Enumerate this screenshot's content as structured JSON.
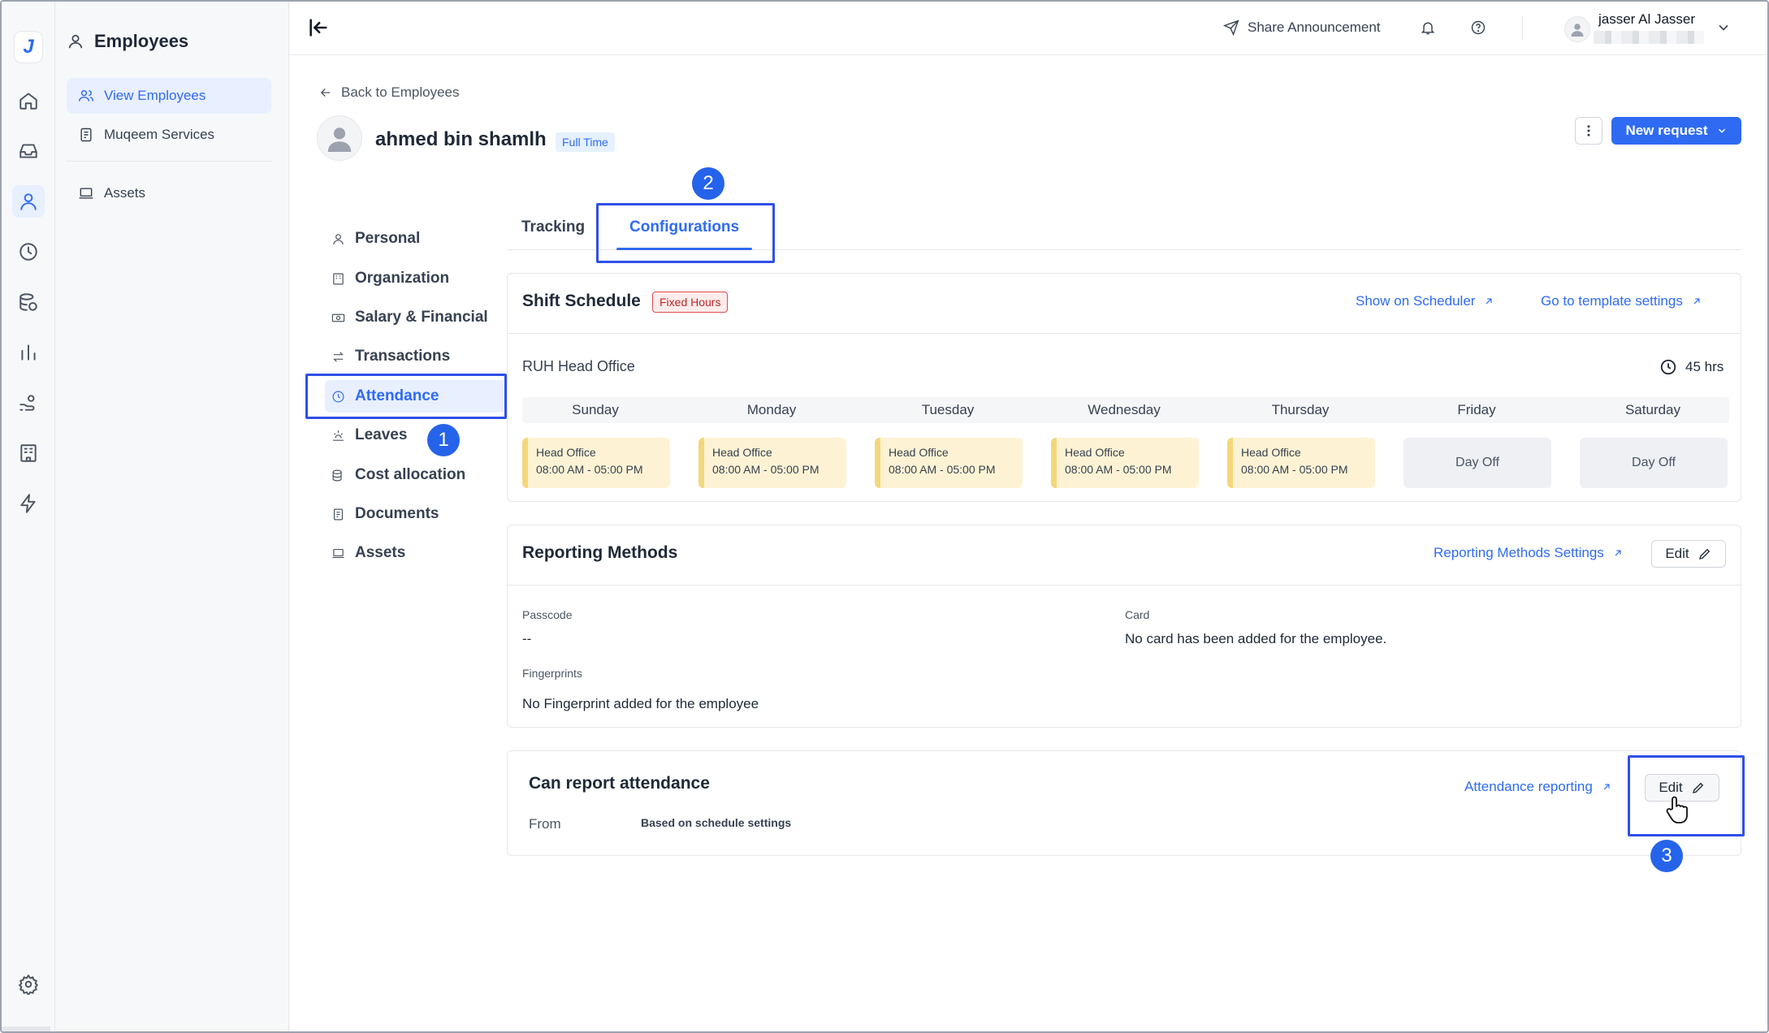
{
  "sidebar": {
    "title": "Employees",
    "items": [
      {
        "label": "View Employees",
        "icon": "users-icon",
        "active": true
      },
      {
        "label": "Muqeem Services",
        "icon": "document-icon"
      },
      {
        "label": "Assets",
        "icon": "laptop-icon"
      }
    ]
  },
  "rail": {
    "logo": "J",
    "icons": [
      "home-icon",
      "inbox-icon",
      "person-icon",
      "clock-icon",
      "database-icon",
      "bar-chart-icon",
      "hand-coins-icon",
      "building-icon",
      "bolt-icon",
      "settings-icon"
    ]
  },
  "topbar": {
    "share_label": "Share Announcement",
    "user_name": "jasser Al Jasser"
  },
  "page": {
    "back_label": "Back to Employees",
    "employee_name": "ahmed bin shamlh",
    "employment_badge": "Full Time",
    "new_request_label": "New request"
  },
  "section_nav": [
    {
      "label": "Personal",
      "icon": "person-icon"
    },
    {
      "label": "Organization",
      "icon": "building-icon"
    },
    {
      "label": "Salary & Financial",
      "icon": "money-icon"
    },
    {
      "label": "Transactions",
      "icon": "arrows-icon"
    },
    {
      "label": "Attendance",
      "icon": "clock-icon",
      "active": true
    },
    {
      "label": "Leaves",
      "icon": "sunset-icon"
    },
    {
      "label": "Cost allocation",
      "icon": "coins-icon"
    },
    {
      "label": "Documents",
      "icon": "document-icon"
    },
    {
      "label": "Assets",
      "icon": "laptop-icon"
    }
  ],
  "tabs": [
    {
      "label": "Tracking"
    },
    {
      "label": "Configurations",
      "active": true
    }
  ],
  "shift_schedule": {
    "title": "Shift Schedule",
    "badge": "Fixed Hours",
    "show_on_scheduler": "Show on Scheduler",
    "template_settings": "Go to template settings",
    "location": "RUH Head Office",
    "total_hours": "45 hrs",
    "days": [
      {
        "day": "Sunday",
        "location": "Head Office",
        "time": "08:00 AM - 05:00 PM"
      },
      {
        "day": "Monday",
        "location": "Head Office",
        "time": "08:00 AM - 05:00 PM"
      },
      {
        "day": "Tuesday",
        "location": "Head Office",
        "time": "08:00 AM - 05:00 PM"
      },
      {
        "day": "Wednesday",
        "location": "Head Office",
        "time": "08:00 AM - 05:00 PM"
      },
      {
        "day": "Thursday",
        "location": "Head Office",
        "time": "08:00 AM - 05:00 PM"
      },
      {
        "day": "Friday",
        "off": "Day Off"
      },
      {
        "day": "Saturday",
        "off": "Day Off"
      }
    ]
  },
  "reporting_methods": {
    "title": "Reporting Methods",
    "settings_link": "Reporting Methods Settings",
    "edit_label": "Edit",
    "passcode_label": "Passcode",
    "passcode_value": "--",
    "card_label": "Card",
    "card_value": "No card has been added for the employee.",
    "fingerprints_label": "Fingerprints",
    "fingerprints_value": "No Fingerprint added for the employee"
  },
  "can_report": {
    "title": "Can report attendance",
    "link": "Attendance reporting",
    "edit_label": "Edit",
    "from_label": "From",
    "from_value": "Based on schedule settings"
  },
  "annotations": [
    "1",
    "2",
    "3"
  ],
  "colors": {
    "accent": "#2f6bf2",
    "annotation": "#2f50e8",
    "shift_bg": "#fdf3d4",
    "badge_red": "#c02626"
  }
}
